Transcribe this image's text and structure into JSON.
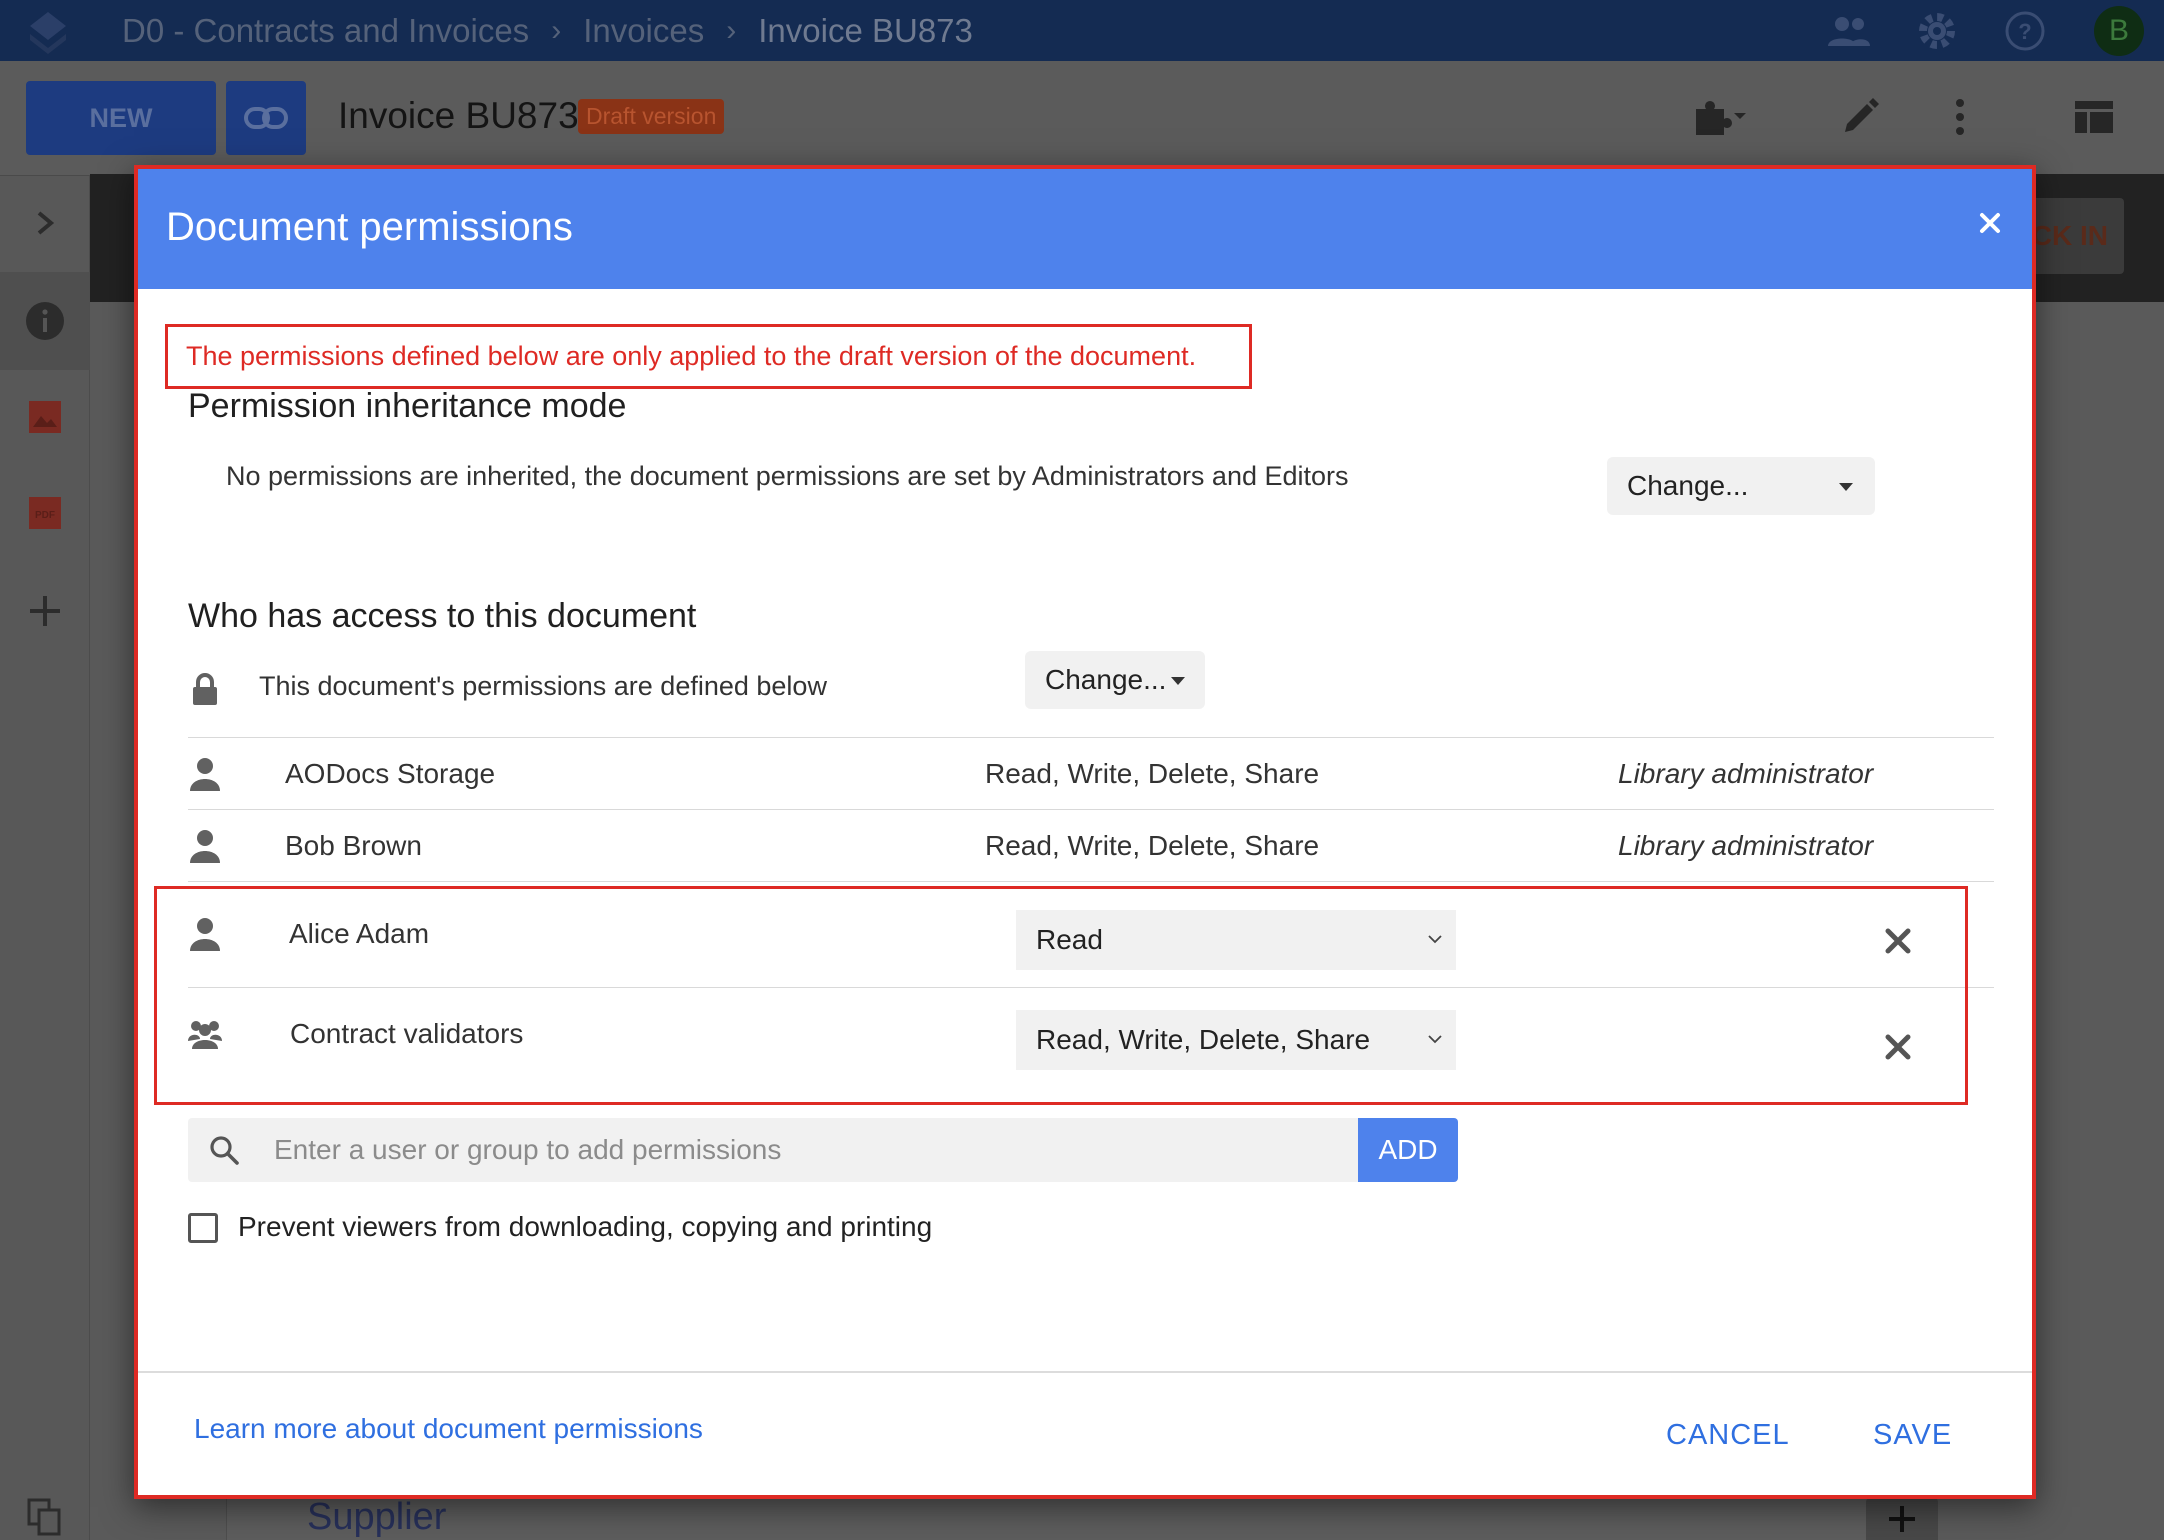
{
  "colors": {
    "accent": "#4e82ec",
    "warning": "#de2a24",
    "topbar": "#142b52",
    "link": "#2f6fe0"
  },
  "topbar": {
    "breadcrumb": [
      "D0 - Contracts and Invoices",
      "Invoices",
      "Invoice BU873"
    ],
    "avatar_initial": "B",
    "icons": [
      "people-icon",
      "gear-icon",
      "help-icon"
    ]
  },
  "toolbar": {
    "new_label": "NEW",
    "doc_title": "Invoice BU873",
    "draft_badge": "Draft version",
    "checkin_label": "CK IN"
  },
  "background": {
    "supplier_label": "Supplier"
  },
  "modal": {
    "title": "Document permissions",
    "warning": "The permissions defined below are only applied to the draft version of the document.",
    "inheritance": {
      "heading": "Permission inheritance mode",
      "text": "No permissions are inherited, the document permissions are set by Administrators and Editors",
      "change_label": "Change..."
    },
    "access": {
      "heading": "Who has access to this document",
      "defined_text": "This document's permissions are defined below",
      "change_label": "Change..."
    },
    "fixed_rows": [
      {
        "name": "AODocs Storage",
        "rights": "Read, Write, Delete, Share",
        "role": "Library administrator"
      },
      {
        "name": "Bob Brown",
        "rights": "Read, Write, Delete, Share",
        "role": "Library administrator"
      }
    ],
    "editable_rows": [
      {
        "name": "Alice Adam",
        "rights": "Read",
        "icon": "user-icon"
      },
      {
        "name": "Contract validators",
        "rights": "Read, Write, Delete, Share",
        "icon": "group-icon"
      }
    ],
    "search": {
      "placeholder": "Enter a user or group to add permissions",
      "value": "",
      "add_label": "ADD"
    },
    "prevent_label": "Prevent viewers from downloading, copying and printing",
    "learn_more": "Learn more about document permissions",
    "cancel_label": "CANCEL",
    "save_label": "SAVE"
  }
}
